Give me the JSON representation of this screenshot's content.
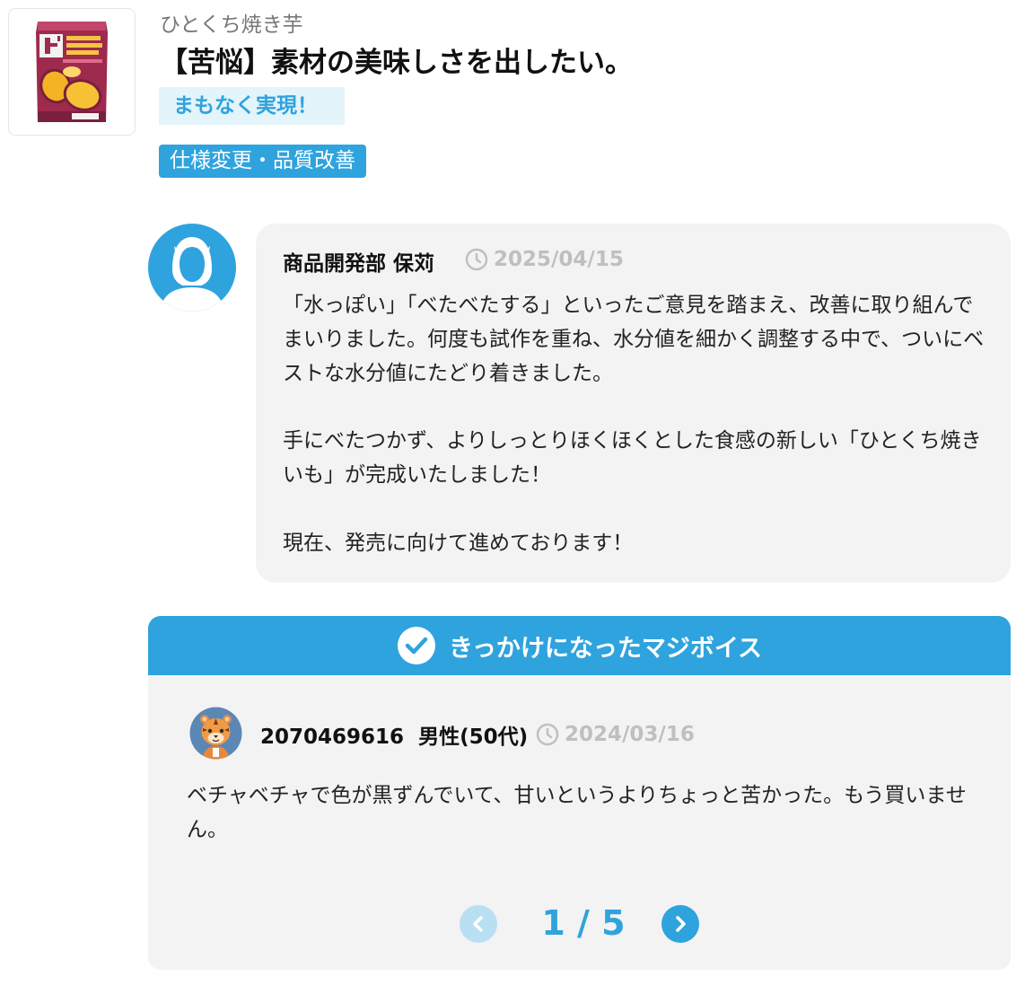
{
  "product": {
    "name": "ひとくち焼き芋",
    "image_icon": "sweet-potato-package-icon"
  },
  "topic": {
    "title": "【苦悩】素材の美味しさを出したい。",
    "status": "まもなく実現！",
    "category": "仕様変更・品質改善"
  },
  "reply": {
    "author": "商品開発部 保苅",
    "date": "2025/04/15",
    "paragraphs": [
      "「水っぽい」「べたべたする」といったご意見を踏まえ、改善に取り組んでまいりました。何度も試作を重ね、水分値を細かく調整する中で、ついにベストな水分値にたどり着きました。",
      "手にべたつかず、よりしっとりほくほくとした食感の新しい「ひとくち焼きいも」が完成いたしました！",
      "現在、発売に向けて進めております！"
    ]
  },
  "voice": {
    "header": "きっかけになったマジボイス",
    "user_id": "2070469616",
    "user_profile": "男性(50代)",
    "date": "2024/03/16",
    "text": "ベチャベチャで色が黒ずんでいて、甘いというよりちょっと苦かった。もう買いません。",
    "pager": {
      "current": "1",
      "separator": "/",
      "total": "5"
    }
  },
  "colors": {
    "accent": "#2fa3dd",
    "accent_light": "#e4f4fb",
    "bubble_bg": "#f3f3f3",
    "muted_date": "#bfbfbf"
  }
}
